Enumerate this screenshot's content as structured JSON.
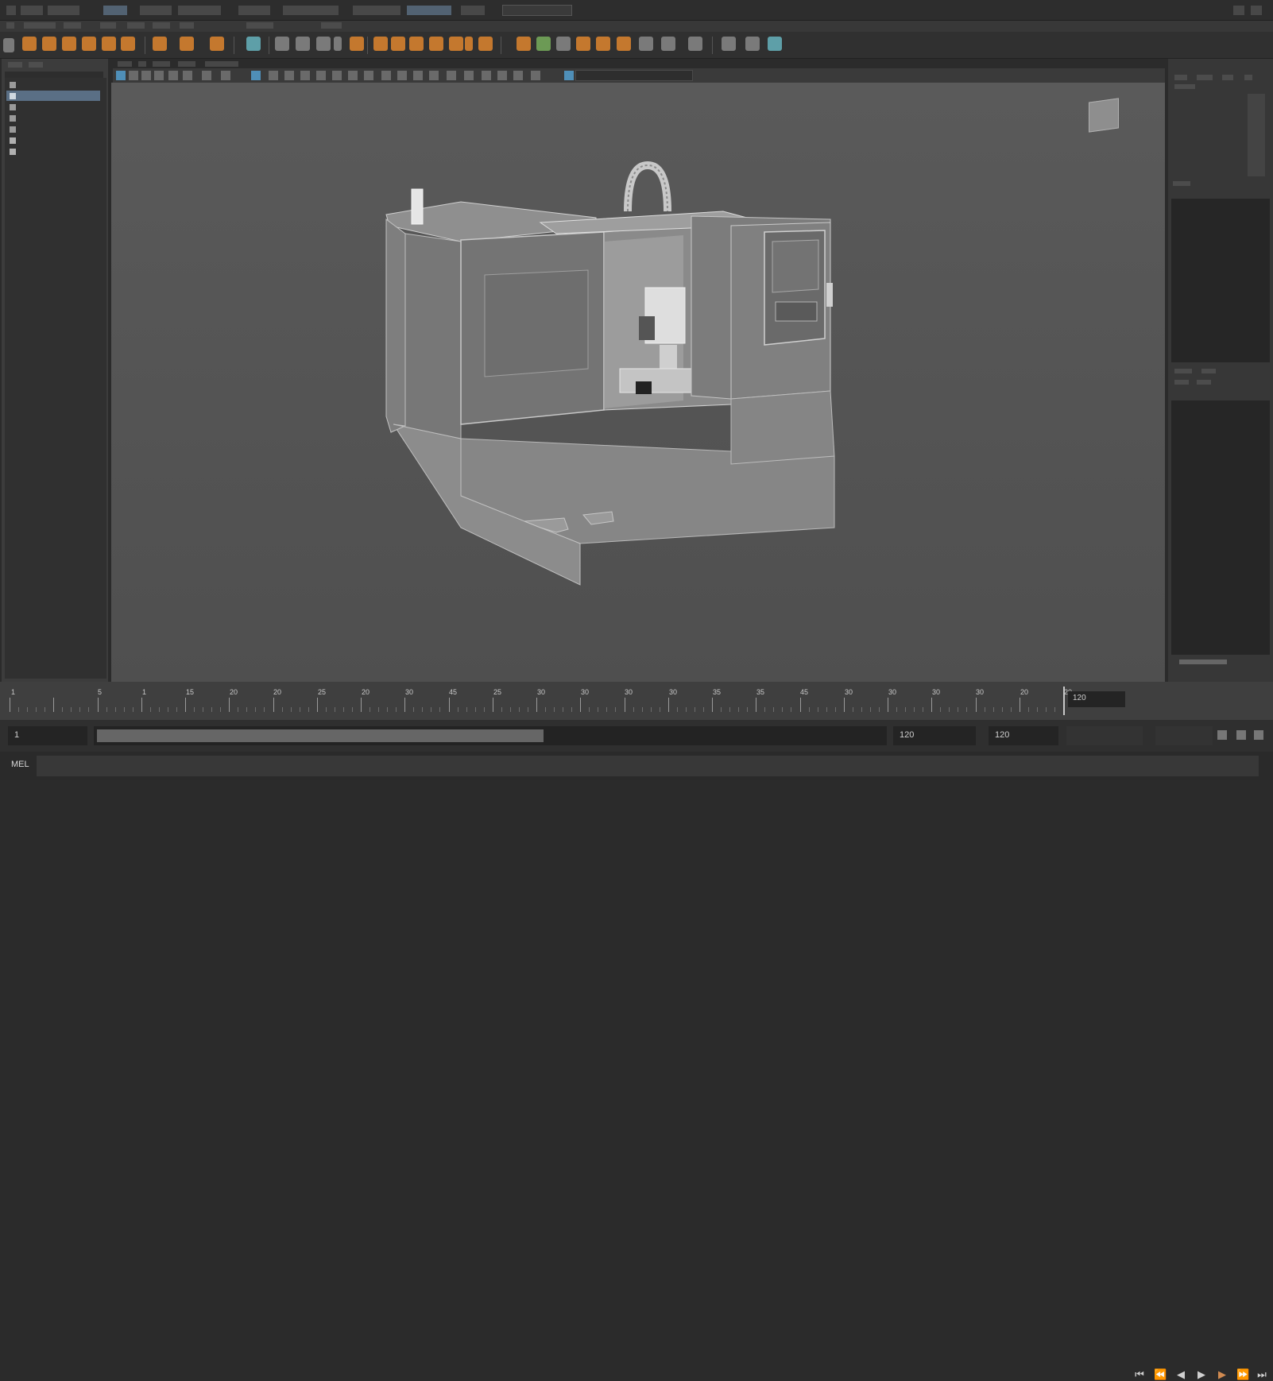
{
  "time_slider": {
    "ticks": [
      "1",
      "5",
      "1",
      "15",
      "20",
      "20",
      "25",
      "20",
      "30",
      "45",
      "25",
      "30",
      "30",
      "30",
      "30",
      "35",
      "35",
      "45",
      "30",
      "30",
      "30",
      "30",
      "20",
      "20"
    ],
    "current_end": "120"
  },
  "range_slider": {
    "start_field": "1",
    "end_field": "120",
    "anim_end_field": "120"
  },
  "command_line": {
    "language": "MEL",
    "value": ""
  },
  "playback": {
    "icons": [
      "go-to-start-icon",
      "step-back-key-icon",
      "step-back-frame-icon",
      "play-forward-icon",
      "step-forward-key-icon",
      "step-forward-frame-icon",
      "go-to-end-icon"
    ]
  },
  "viewport": {
    "model": "machining-center-3d-model",
    "view_cube": "view-cube"
  },
  "colors": {
    "accent_orange": "#c4782e",
    "accent_teal": "#5e9fa8",
    "selection_blue": "#5a6f85",
    "viewport_bg": "#555555"
  }
}
